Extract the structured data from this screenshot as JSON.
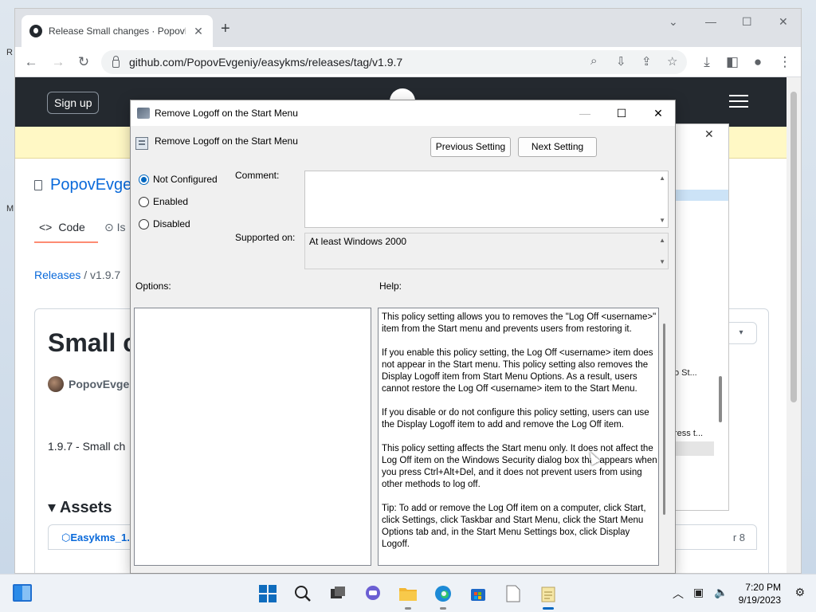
{
  "browser": {
    "tab_title": "Release Small changes · PopovEv",
    "new_tab": "+",
    "url": "github.com/PopovEvgeniy/easykms/releases/tag/v1.9.7"
  },
  "github": {
    "sign_up": "Sign up",
    "repo": "PopovEvge",
    "code_tab": "Code",
    "issues_tab": "Is",
    "crumb_releases": "Releases",
    "crumb_sep": "/",
    "crumb_version": "v1.9.7",
    "release_title": "Small c",
    "author": "PopovEvgen",
    "release_body": "1.9.7 - Small ch",
    "assets_title": "Assets",
    "asset_name": "Easykms_1.",
    "asset_date": "r 8"
  },
  "bg_window": {
    "line1": "o St...",
    "line2": "ress t..."
  },
  "dialog": {
    "title": "Remove Logoff on the Start Menu",
    "header": "Remove Logoff on the Start Menu",
    "prev_button": "Previous Setting",
    "next_button": "Next Setting",
    "options": [
      {
        "label": "Not Configured",
        "selected": true
      },
      {
        "label": "Enabled",
        "selected": false
      },
      {
        "label": "Disabled",
        "selected": false
      }
    ],
    "comment_label": "Comment:",
    "supported_label": "Supported on:",
    "supported_value": "At least Windows 2000",
    "options_label": "Options:",
    "help_label": "Help:",
    "help": [
      "This policy setting allows you to removes the \"Log Off <username>\" item from the Start menu and prevents users from restoring it.",
      "If you enable this policy setting, the Log Off <username> item does not appear in the Start menu. This policy setting also removes the Display Logoff item from Start Menu Options. As a result, users cannot restore the Log Off <username> item to the Start Menu.",
      "If you disable or do not configure this policy setting, users can use the Display Logoff item to add and remove the Log Off item.",
      "This policy setting affects the Start menu only. It does not affect the Log Off item on the Windows Security dialog box that appears when you press Ctrl+Alt+Del, and it does not prevent users from using other methods to log off.",
      "Tip: To add or remove the Log Off item on a computer, click Start, click Settings, click Taskbar and Start Menu, click the Start Menu Options tab and, in the Start Menu Settings box, click Display Logoff."
    ]
  },
  "taskbar": {
    "time": "7:20 PM",
    "date": "9/19/2023"
  },
  "desktop": {
    "frag_r": "R",
    "frag_m": "M"
  }
}
